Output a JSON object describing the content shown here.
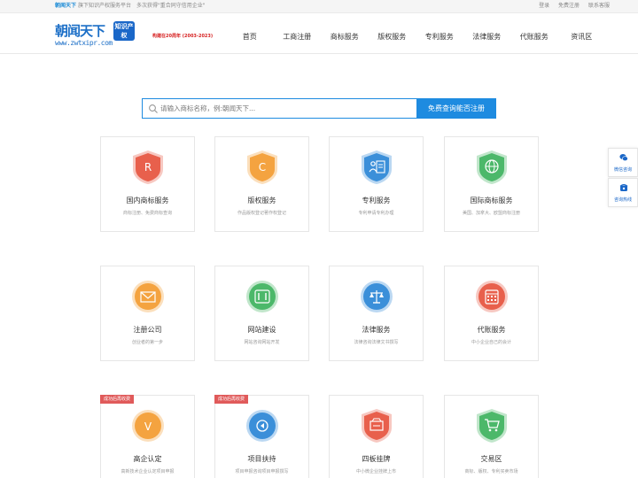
{
  "topbar": {
    "brand": "朝闻天下",
    "slogan": "旗下知识产权服务平台",
    "tagline": "多次获得\"重合同守信用企业\"",
    "links": [
      "登录",
      "免费注册",
      "联系客服"
    ]
  },
  "logo": {
    "name": "朝闻天下",
    "seal": "知识产权",
    "url": "www.zwtxipr.com",
    "anniversary": "构建在20周年 (2003-2023)"
  },
  "nav": [
    "首页",
    "工商注册",
    "商标服务",
    "版权服务",
    "专利服务",
    "法律服务",
    "代账服务",
    "资讯区"
  ],
  "search": {
    "placeholder": "请输入商标名称，例:朝闻天下...",
    "button": "免费查询能否注册"
  },
  "cards": [
    {
      "title": "国内商标服务",
      "desc": "商标注册、免费商标查询",
      "icon": "trademark-r-icon",
      "color": "#e8604c",
      "ribbon": ""
    },
    {
      "title": "版权服务",
      "desc": "作品版权登记著作权登记",
      "icon": "copyright-c-icon",
      "color": "#f4a340",
      "ribbon": ""
    },
    {
      "title": "专利服务",
      "desc": "专利申请专利办理",
      "icon": "patent-document-icon",
      "color": "#3b8fd9",
      "ribbon": ""
    },
    {
      "title": "国际商标服务",
      "desc": "美国、加拿大、欧盟商标注册",
      "icon": "globe-icon",
      "color": "#4cb86a",
      "ribbon": ""
    },
    {
      "title": "注册公司",
      "desc": "创业者的第一步",
      "icon": "envelope-icon",
      "color": "#f4a340",
      "ribbon": ""
    },
    {
      "title": "网站建设",
      "desc": "网站咨询网站开发",
      "icon": "tools-icon",
      "color": "#4cb86a",
      "ribbon": ""
    },
    {
      "title": "法律服务",
      "desc": "法律咨询法律文书撰写",
      "icon": "scales-icon",
      "color": "#3b8fd9",
      "ribbon": ""
    },
    {
      "title": "代账服务",
      "desc": "中小企业自己的会计",
      "icon": "calculator-icon",
      "color": "#e8604c",
      "ribbon": ""
    },
    {
      "title": "高企认定",
      "desc": "高新技术企业认定项目申报",
      "icon": "v-icon",
      "color": "#f4a340",
      "ribbon": "成功后再收费"
    },
    {
      "title": "项目扶持",
      "desc": "项目申报咨询项目申报撰写",
      "icon": "arrow-circle-icon",
      "color": "#3b8fd9",
      "ribbon": "成功后再收费"
    },
    {
      "title": "四板挂牌",
      "desc": "中小微企业挂牌上市",
      "icon": "card-icon",
      "color": "#e8604c",
      "ribbon": ""
    },
    {
      "title": "交易区",
      "desc": "商标、版权、专利买卖市场",
      "icon": "cart-icon",
      "color": "#4cb86a",
      "ribbon": ""
    }
  ],
  "side": [
    {
      "label": "微信咨询",
      "icon": "wechat-icon"
    },
    {
      "label": "咨询热线",
      "icon": "phone-icon"
    }
  ]
}
